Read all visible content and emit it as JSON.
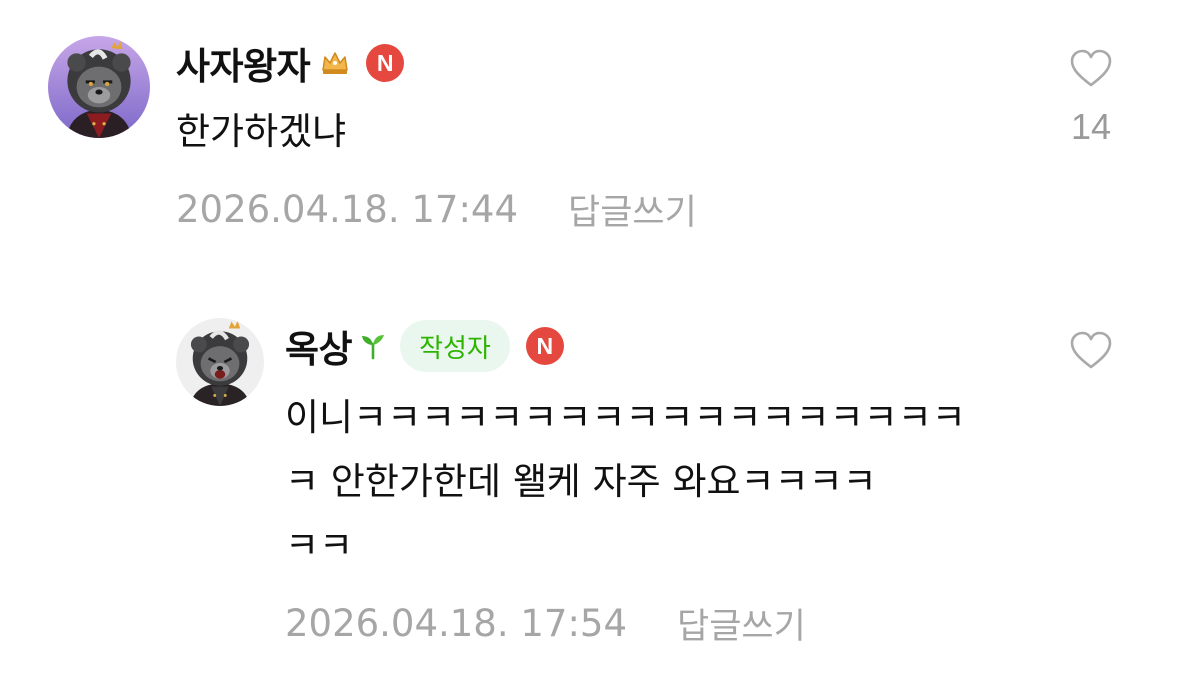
{
  "comments": [
    {
      "nickname": "사자왕자",
      "badge_icon": "crown-icon",
      "n_badge": "N",
      "text": "한가하겠냐",
      "date": "2026.04.18. 17:44",
      "reply_label": "답글쓰기",
      "like_count": "14"
    },
    {
      "nickname": "옥상",
      "badge_icon": "sprout-icon",
      "author_tag": "작성자",
      "n_badge": "N",
      "text": "이니ㅋㅋㅋㅋㅋㅋㅋㅋㅋㅋㅋㅋㅋㅋㅋㅋㅋㅋ\nㅋ 안한가한데 왤케 자주 와요ㅋㅋㅋㅋ\nㅋㅋ",
      "date": "2026.04.18. 17:54",
      "reply_label": "답글쓰기"
    }
  ],
  "colors": {
    "n_badge": "#e5483f",
    "author_tag_bg": "#eaf7ee",
    "author_tag_text": "#2db400",
    "meta_text": "#a6a6a6"
  }
}
